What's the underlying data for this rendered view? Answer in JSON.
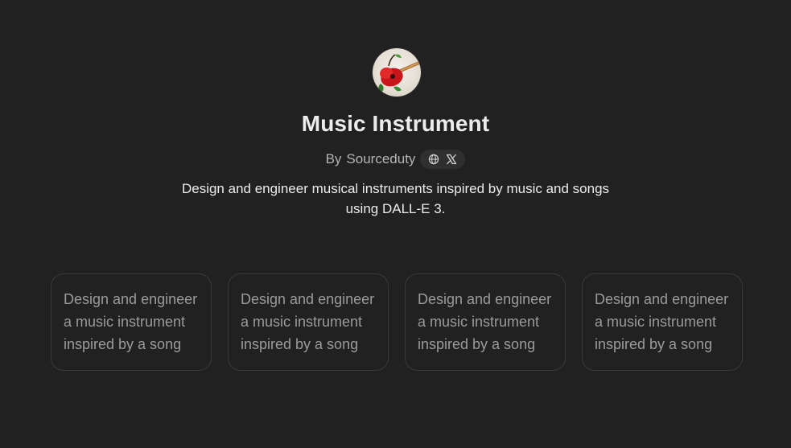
{
  "gpt": {
    "avatar_icon": "guitar-avatar-icon",
    "title": "Music Instrument",
    "byline_prefix": "By",
    "author": "Sourceduty",
    "social_icons": [
      "globe-icon",
      "x-logo-icon"
    ],
    "description": "Design and engineer musical instruments inspired by music and songs using DALL-E 3."
  },
  "starters": [
    {
      "text": "Design and engineer a music instrument inspired by a song"
    },
    {
      "text": "Design and engineer a music instrument inspired by a song"
    },
    {
      "text": "Design and engineer a music instrument inspired by a song"
    },
    {
      "text": "Design and engineer a music instrument inspired by a song"
    }
  ],
  "colors": {
    "background": "#212121",
    "text": "#ececec",
    "muted": "#b4b4b4",
    "card_border": "#3a3a3a",
    "pill_bg": "#2f2f2f"
  }
}
